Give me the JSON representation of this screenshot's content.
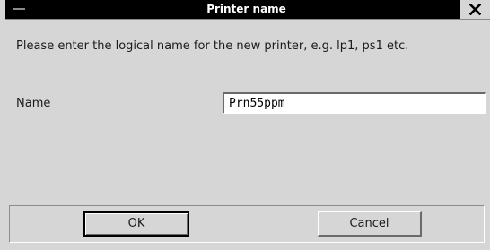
{
  "dialog": {
    "title": "Printer name",
    "prompt": "Please enter the logical name for the new printer, e.g. lp1, ps1 etc.",
    "name_label": "Name",
    "name_value": "Prn55ppm",
    "ok_label": "OK",
    "cancel_label": "Cancel",
    "icons": {
      "system_menu": "window-menu-icon",
      "close": "close-icon"
    }
  }
}
